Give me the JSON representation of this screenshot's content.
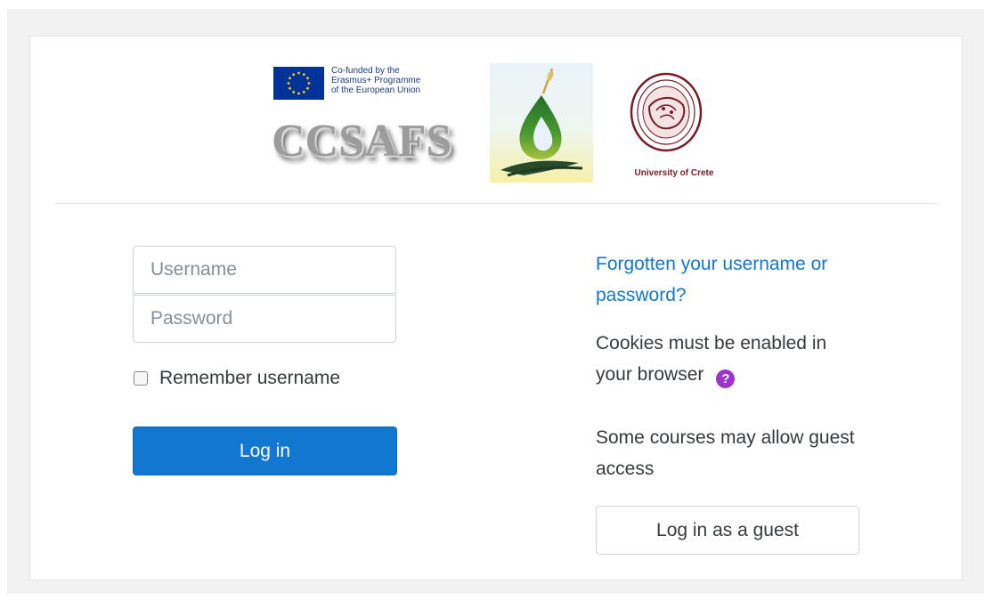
{
  "header": {
    "eu_funding_text": [
      "Co-funded by the",
      "Erasmus+ Programme",
      "of the European Union"
    ],
    "ccsafs_wordmark": "CCSAFS",
    "university_caption": "University of Crete"
  },
  "login": {
    "username_placeholder": "Username",
    "password_placeholder": "Password",
    "remember_label": "Remember username",
    "login_button": "Log in"
  },
  "side": {
    "forgot_link": "Forgotten your username or password?",
    "cookies_text": "Cookies must be enabled in your browser",
    "help_icon": "question-circle-icon",
    "guest_text": "Some courses may allow guest access",
    "guest_button": "Log in as a guest"
  },
  "colors": {
    "primary": "#1177d1",
    "help_icon": "#9b34c9",
    "eu_blue": "#003399",
    "eu_star": "#ffcc00",
    "uoc_maroon": "#7b1a26"
  }
}
